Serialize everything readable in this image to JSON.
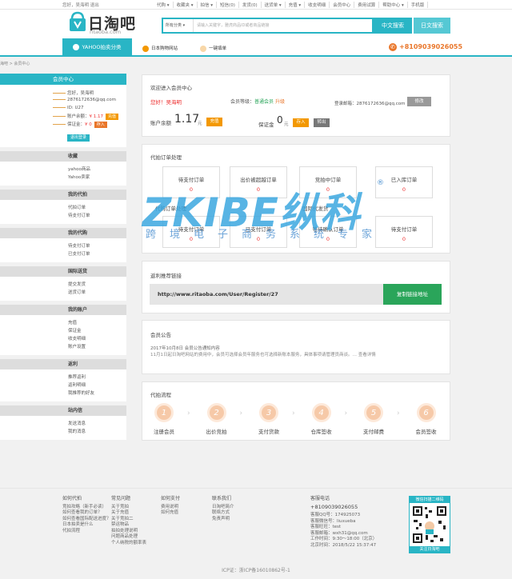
{
  "topbar": {
    "greeting": "您好，吴海明 退出",
    "links": [
      "代购 ▾",
      "收藏夹 ▾",
      "拍信 ▾",
      "短信(0)",
      "发货(0)",
      "送货单 ▾",
      "充值 ▾",
      "收支明细",
      "会员中心",
      "费用试算",
      "帮助中心 ▾",
      "手机版"
    ]
  },
  "logo": {
    "cn": "日淘吧",
    "en": "ritaoba.com"
  },
  "search": {
    "select": "所有分类",
    "placeholder": "请输入关键字，雅虎商品ID或者商品链接",
    "btn_cn": "中文搜索",
    "btn_jp": "日文搜索"
  },
  "nav": {
    "category": "YAHOO拍卖分类",
    "item1": "日本购物网站",
    "item2": "一键填单",
    "phone": "+8109039026055"
  },
  "breadcrumb": "海吧 > 会员中心",
  "user": {
    "header": "会员中心",
    "line1": "您好，吴海明",
    "line2": "2876172636@qq.com",
    "line3": "ID: U27",
    "balance_label": "账户余额：",
    "balance": "¥ 1.17",
    "recharge": "充值",
    "deposit_label": "保证金：",
    "deposit": "¥ 0",
    "deposit_btn": "存入",
    "logout": "退出登录"
  },
  "sidebar": [
    {
      "title": "收藏",
      "items": [
        "yahoo商品",
        "Yahoo卖家"
      ]
    },
    {
      "title": "我的代拍",
      "items": [
        "代拍订单",
        "待支付订单"
      ]
    },
    {
      "title": "我的代购",
      "items": [
        "待支付订单",
        "已支付订单"
      ]
    },
    {
      "title": "国际送货",
      "items": [
        "提交发货",
        "送货订单"
      ]
    },
    {
      "title": "我的账户",
      "items": [
        "充值",
        "保证金",
        "收支明细",
        "账户设置"
      ]
    },
    {
      "title": "返利",
      "items": [
        "推荐返利",
        "返利明细",
        "我推荐的好友"
      ]
    },
    {
      "title": "站内信",
      "items": [
        "发送消息",
        "我的消息"
      ]
    }
  ],
  "welcome": {
    "title": "欢迎进入会员中心",
    "hello": "您好！吴海明",
    "level_label": "会员等级：",
    "level": "普通会员",
    "upgrade": "升级",
    "login_label": "登录邮箱：",
    "email": "2876172636@qq.com",
    "edit": "修改",
    "balance_label": "账户余额",
    "balance": "1.17",
    "unit": "元",
    "recharge": "充值",
    "deposit_label": "保证金",
    "deposit": "0",
    "deposit_btn": "存入",
    "withdraw": "转出"
  },
  "auction": {
    "title": "代拍订单处理",
    "cards": [
      {
        "label": "待支付订单",
        "count": "0"
      },
      {
        "label": "出价被超越订单",
        "count": "0"
      },
      {
        "label": "竞拍中订单",
        "count": "0"
      },
      {
        "label": "已入库订单",
        "count": "0"
      }
    ]
  },
  "purchase": {
    "title": "代购订单处理",
    "title2": "国际代发货",
    "cards": [
      {
        "label": "待支付订单",
        "count": "0"
      },
      {
        "label": "已支付订单",
        "count": "0"
      },
      {
        "label": "等待确认订单",
        "count": "0"
      },
      {
        "label": "待支付订单",
        "count": "0"
      }
    ]
  },
  "referral": {
    "title": "返利推荐链接",
    "url": "http://www.ritaoba.com/User/Register/27",
    "copy": "复制链接地址"
  },
  "notice": {
    "title": "会员公告",
    "date": "2017年10月8日 会员公告通知内容",
    "text": "11月1日起日淘吧网站的费用中，会员可选择会员年服务也可选择新账本服务，具体事项请管理员商谈。… 查看详情"
  },
  "process": {
    "title": "代拍流程",
    "steps": [
      {
        "n": "1",
        "label": "注册会员"
      },
      {
        "n": "2",
        "label": "出价竞拍"
      },
      {
        "n": "3",
        "label": "支付货款"
      },
      {
        "n": "4",
        "label": "仓库签收"
      },
      {
        "n": "5",
        "label": "支付邮费"
      },
      {
        "n": "6",
        "label": "会员签收"
      }
    ]
  },
  "watermark": {
    "logo": "ZKIBE纵科",
    "sub": "跨境电子商务系统专家"
  },
  "footer": {
    "cols": [
      {
        "title": "如何代拍",
        "items": [
          "竞拍攻略（新手必读）",
          "如何查看我的订单？",
          "如何查看国际配送进度？",
          "日本拍卖是什么",
          "代拍流程"
        ]
      },
      {
        "title": "常见问题",
        "items": [
          "关于竞拍",
          "关于充值",
          "关于竞拍二",
          "禁运物品",
          "拍拍处理说明",
          "问题商品处理",
          "个人纳税的额率表"
        ]
      },
      {
        "title": "如何支付",
        "items": [
          "费用说明",
          "如何充值"
        ]
      },
      {
        "title": "联系我们",
        "items": [
          "日淘吧简介",
          "联络方式",
          "免责声明"
        ]
      }
    ],
    "service": {
      "title": "客服电话",
      "phone": "+8109039026055",
      "lines": [
        "客服QQ号：174925073",
        "客服微信号：liuxueba",
        "客服旺旺：test",
        "客服邮箱：wxh31@qq.com",
        "工作时间：9:30～18:00（北京）",
        "北京时间：2018/5/22 15:37:47"
      ]
    },
    "qr_top": "微信扫描二维码",
    "qr_bottom": "关注日淘吧",
    "icp": "ICP证：浙ICP备16010862号-1"
  }
}
